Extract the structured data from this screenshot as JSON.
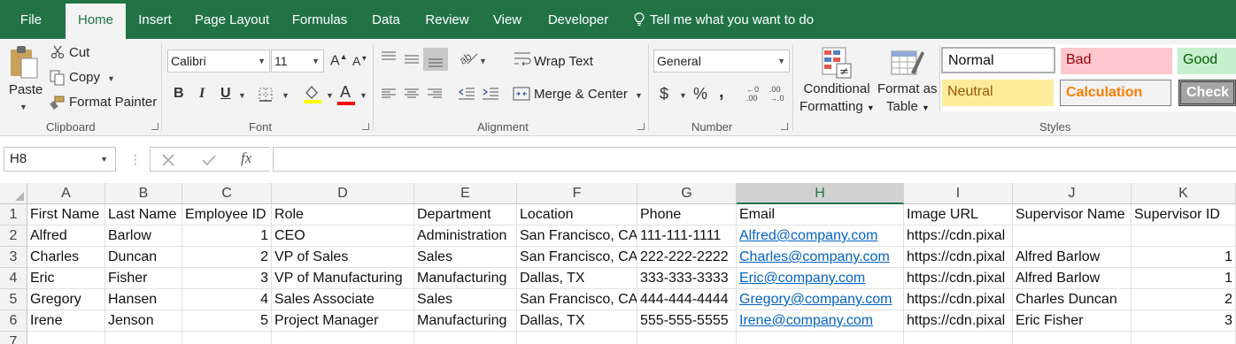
{
  "menu": {
    "tabs": [
      "File",
      "Home",
      "Insert",
      "Page Layout",
      "Formulas",
      "Data",
      "Review",
      "View",
      "Developer"
    ],
    "active_tab": "Home",
    "tell_me": "Tell me what you want to do"
  },
  "ribbon": {
    "clipboard": {
      "paste": "Paste",
      "cut": "Cut",
      "copy": "Copy",
      "format_painter": "Format Painter",
      "title": "Clipboard"
    },
    "font": {
      "font_name": "Calibri",
      "font_size": "11",
      "bold": "B",
      "italic": "I",
      "underline": "U",
      "grow_glyph": "A",
      "shrink_glyph": "A",
      "font_color_glyph": "A",
      "title": "Font"
    },
    "alignment": {
      "wrap_text": "Wrap Text",
      "merge_center": "Merge & Center",
      "title": "Alignment"
    },
    "number": {
      "format": "General",
      "currency": "$",
      "percent": "%",
      "comma": ",",
      "inc_decimal_top": "←0",
      "inc_decimal_bottom": ".00",
      "dec_decimal_top": ".00",
      "dec_decimal_bottom": "→.0",
      "title": "Number"
    },
    "styles": {
      "conditional_line1": "Conditional",
      "conditional_line2": "Formatting",
      "format_table_line1": "Format as",
      "format_table_line2": "Table",
      "normal": "Normal",
      "bad": "Bad",
      "good": "Good",
      "neutral": "Neutral",
      "calculation": "Calculation",
      "check_cell": "Check C",
      "title": "Styles"
    }
  },
  "formula_bar": {
    "name_box": "H8",
    "fx": "fx",
    "content": ""
  },
  "sheet": {
    "columns": [
      "A",
      "B",
      "C",
      "D",
      "E",
      "F",
      "G",
      "H",
      "I",
      "J",
      "K"
    ],
    "selected_column": "H",
    "rows": [
      [
        "First Name",
        "Last Name",
        "Employee ID",
        "Role",
        "Department",
        "Location",
        "Phone",
        "Email",
        "Image URL",
        "Supervisor Name",
        "Supervisor ID"
      ],
      [
        "Alfred",
        "Barlow",
        "1",
        "CEO",
        "Administration",
        "San Francisco, CA",
        "111-111-1111",
        "Alfred@company.com",
        "https://cdn.pixal",
        "",
        ""
      ],
      [
        "Charles",
        "Duncan",
        "2",
        "VP of Sales",
        "Sales",
        "San Francisco, CA",
        "222-222-2222",
        "Charles@company.com",
        "https://cdn.pixal",
        "Alfred Barlow",
        "1"
      ],
      [
        "Eric",
        "Fisher",
        "3",
        "VP of Manufacturing",
        "Manufacturing",
        "Dallas, TX",
        "333-333-3333",
        "Eric@company.com",
        "https://cdn.pixal",
        "Alfred Barlow",
        "1"
      ],
      [
        "Gregory",
        "Hansen",
        "4",
        "Sales Associate",
        "Sales",
        "San Francisco, CA",
        "444-444-4444",
        "Gregory@company.com",
        "https://cdn.pixal",
        "Charles Duncan",
        "2"
      ],
      [
        "Irene",
        "Jenson",
        "5",
        "Project Manager",
        "Manufacturing",
        "Dallas, TX",
        "555-555-5555",
        "Irene@company.com",
        "https://cdn.pixal",
        "Eric Fisher",
        "3"
      ],
      [
        "",
        "",
        "",
        "",
        "",
        "",
        "",
        "",
        "",
        "",
        ""
      ]
    ],
    "row_numbers": [
      "1",
      "2",
      "3",
      "4",
      "5",
      "6",
      "7"
    ]
  },
  "colors": {
    "accent": "#217346",
    "hyperlink": "#0563c1",
    "bad_fill": "#ffc7ce",
    "bad_text": "#9c0006",
    "good_fill": "#c6efce",
    "good_text": "#006100",
    "neutral_fill": "#ffeb9c",
    "neutral_text": "#9c5700",
    "calculation_text": "#fa7d00"
  }
}
